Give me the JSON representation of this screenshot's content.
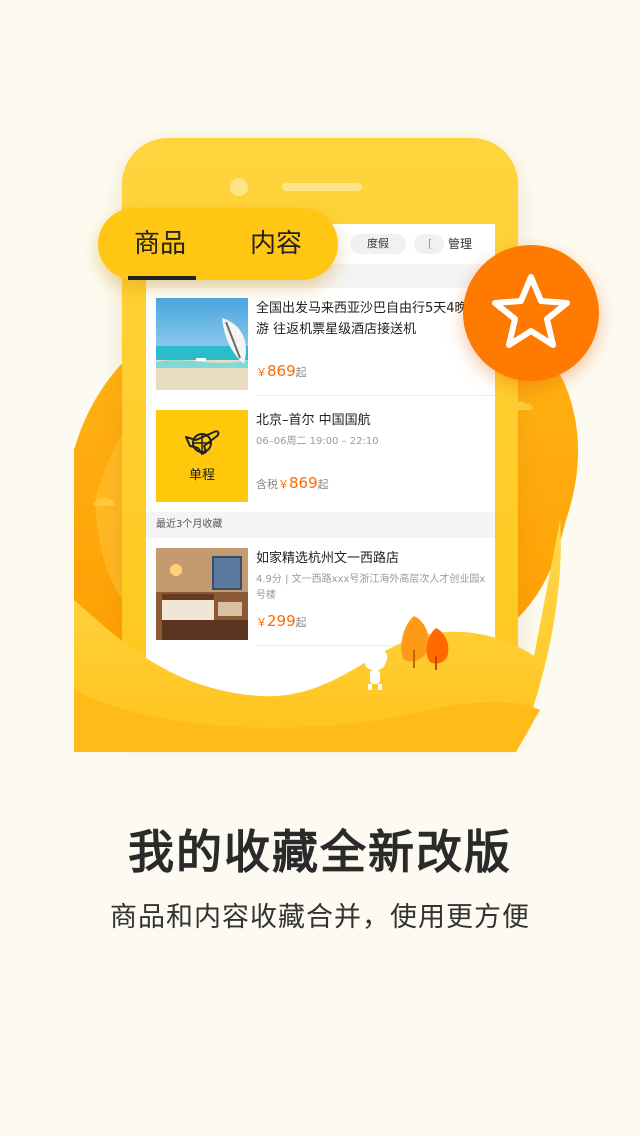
{
  "tabs": {
    "goods": "商品",
    "content": "内容"
  },
  "filters": {
    "vacation": "度假",
    "partial": "[",
    "manage": "管理"
  },
  "items": [
    {
      "title": "全国出发马来西亚沙巴自由行5天4晚旅游 往返机票星级酒店接送机",
      "currency": "￥",
      "price": "869",
      "suffix": "起"
    },
    {
      "title": "北京–首尔 中国国航",
      "meta": "06–06周二  19:00 – 22:10",
      "thumb_label": "单程",
      "tax_prefix": "含税",
      "currency": "￥",
      "price": "869",
      "suffix": "起"
    },
    {
      "title": "如家精选杭州文一西路店",
      "meta": "4.9分 | 文一西路xxx号浙江海外高层次人才创业园x号楼",
      "currency": "￥",
      "price": "299",
      "suffix": "起"
    }
  ],
  "section_label": "最近3个月收藏",
  "headline": "我的收藏全新改版",
  "subline": "商品和内容收藏合并，使用更方便",
  "colors": {
    "background": "#fdfbf1",
    "phone_yellow": "#ffd43d",
    "accent_orange": "#ff7a00",
    "price_orange": "#ff6a00"
  },
  "icons": {
    "flight": "airplane-globe-icon",
    "favorite": "star-icon"
  }
}
